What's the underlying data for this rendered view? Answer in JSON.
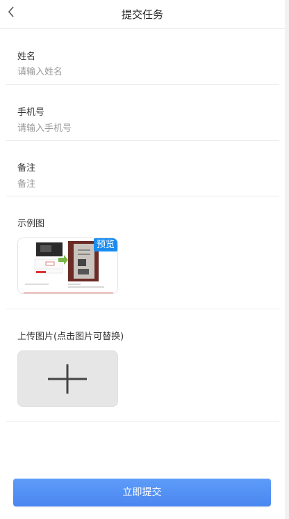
{
  "header": {
    "title": "提交任务",
    "back_icon": "chevron-left-icon"
  },
  "form": {
    "name": {
      "label": "姓名",
      "placeholder": "请输入姓名",
      "value": ""
    },
    "phone": {
      "label": "手机号",
      "placeholder": "请输入手机号",
      "value": ""
    },
    "remark": {
      "label": "备注",
      "placeholder": "备注",
      "value": ""
    }
  },
  "example": {
    "label": "示例图",
    "preview_badge": "预览"
  },
  "upload": {
    "label": "上传图片(点击图片可替换)",
    "icon": "plus-icon"
  },
  "submit": {
    "label": "立即提交"
  },
  "colors": {
    "accent": "#4a86f0",
    "badge": "#1a8cf0"
  }
}
